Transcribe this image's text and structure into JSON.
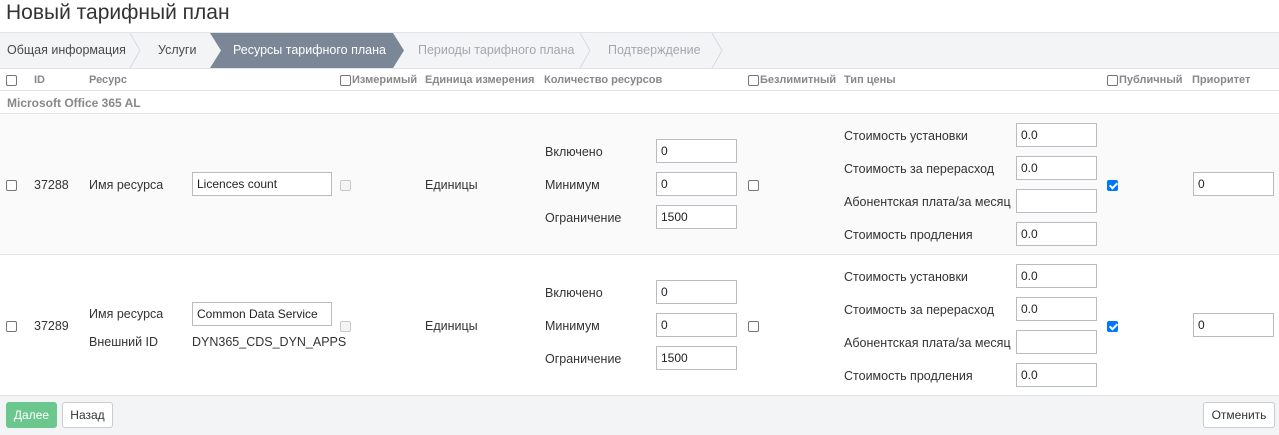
{
  "page_title": "Новый тарифный план",
  "wizard": {
    "steps": [
      {
        "label": "Общая информация",
        "state": "done"
      },
      {
        "label": "Услуги",
        "state": "done"
      },
      {
        "label": "Ресурсы тарифного плана",
        "state": "active"
      },
      {
        "label": "Периоды тарифного плана",
        "state": "pending"
      },
      {
        "label": "Подтверждение",
        "state": "pending"
      }
    ]
  },
  "table": {
    "columns": {
      "id": "ID",
      "resource": "Ресурс",
      "measurable": "Измеримый",
      "unit": "Единица измерения",
      "quantity": "Количество ресурсов",
      "unlimited": "Безлимитный",
      "price_type": "Тип цены",
      "public": "Публичный",
      "priority": "Приоритет"
    },
    "group_label": "Microsoft Office 365 AL",
    "rows": [
      {
        "id": "37288",
        "resource_name_label": "Имя ресурса",
        "resource_name_value": "Licences count",
        "external_id_label": "",
        "external_id_value": "",
        "unit": "Единицы",
        "included_label": "Включено",
        "included_value": "0",
        "minimum_label": "Минимум",
        "minimum_value": "0",
        "limit_label": "Ограничение",
        "limit_value": "1500",
        "setup_fee_label": "Стоимость установки",
        "setup_fee_value": "0.0",
        "overuse_fee_label": "Стоимость за перерасход",
        "overuse_fee_value": "0.0",
        "subscription_fee_label": "Абонентская плата/за месяц",
        "subscription_fee_value": "",
        "renewal_fee_label": "Стоимость продления",
        "renewal_fee_value": "0.0",
        "public_checked": true,
        "priority_value": "0"
      },
      {
        "id": "37289",
        "resource_name_label": "Имя ресурса",
        "resource_name_value": "Common Data Service",
        "external_id_label": "Внешний ID",
        "external_id_value": "DYN365_CDS_DYN_APPS",
        "unit": "Единицы",
        "included_label": "Включено",
        "included_value": "0",
        "minimum_label": "Минимум",
        "minimum_value": "0",
        "limit_label": "Ограничение",
        "limit_value": "1500",
        "setup_fee_label": "Стоимость установки",
        "setup_fee_value": "0.0",
        "overuse_fee_label": "Стоимость за перерасход",
        "overuse_fee_value": "0.0",
        "subscription_fee_label": "Абонентская плата/за месяц",
        "subscription_fee_value": "",
        "renewal_fee_label": "Стоимость продления",
        "renewal_fee_value": "0.0",
        "public_checked": true,
        "priority_value": "0"
      }
    ]
  },
  "footer": {
    "next_label": "Далее",
    "back_label": "Назад",
    "cancel_label": "Отменить"
  },
  "colors": {
    "active_step": "#7b8697",
    "next_button": "#6cc78f",
    "checkbox_checked": "#0075ff"
  }
}
